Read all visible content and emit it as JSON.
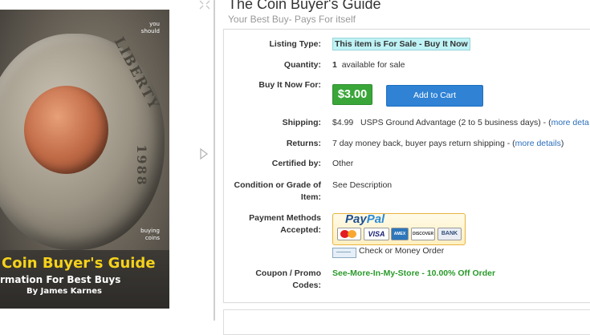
{
  "product_image": {
    "cover_top_text": "you\nshould",
    "cover_bottom_text": "buying\ncoins",
    "coin_liberty": "LIBERTY",
    "coin_year": "1988",
    "cover_title": "Coin Buyer's Guide",
    "cover_subtitle": "rmation For Best Buys",
    "cover_author": "By James Karnes"
  },
  "header": {
    "title": "The Coin Buyer's Guide",
    "subtitle": "Your Best Buy- Pays For itself"
  },
  "details": {
    "listing_type_label": "Listing Type:",
    "listing_type_value": "This item is For Sale - Buy It Now",
    "quantity_label": "Quantity:",
    "quantity_value": "1",
    "quantity_suffix": "available for sale",
    "buy_now_label": "Buy It Now For:",
    "price": "$3.00",
    "add_to_cart": "Add to Cart",
    "shipping_label": "Shipping:",
    "shipping_cost": "$4.99",
    "shipping_method": "USPS Ground Advantage (2 to 5 business days) - (",
    "shipping_link": "more deta",
    "returns_label": "Returns:",
    "returns_text": "7 day money back, buyer pays return shipping - (",
    "returns_link": "more details",
    "returns_close": ")",
    "certified_label": "Certified by:",
    "certified_value": "Other",
    "condition_label_1": "Condition or Grade of",
    "condition_label_2": "Item:",
    "condition_value": "See Description",
    "payment_label_1": "Payment Methods",
    "payment_label_2": "Accepted:",
    "paypal_pay": "Pay",
    "paypal_pal": "Pal",
    "visa": "VISA",
    "amex": "AMEX",
    "discover": "DISCOVER",
    "bank": "BANK",
    "check_text": "Check or Money Order",
    "coupon_label_1": "Coupon / Promo",
    "coupon_label_2": "Codes:",
    "coupon_value": "See-More-In-My-Store - 10.00% Off Order"
  },
  "colors": {
    "price_button": "#3aa63a",
    "cart_button": "#2f82d4",
    "link": "#2a6ebb",
    "coupon": "#2a9a2a",
    "highlight": "#bff3f6"
  }
}
